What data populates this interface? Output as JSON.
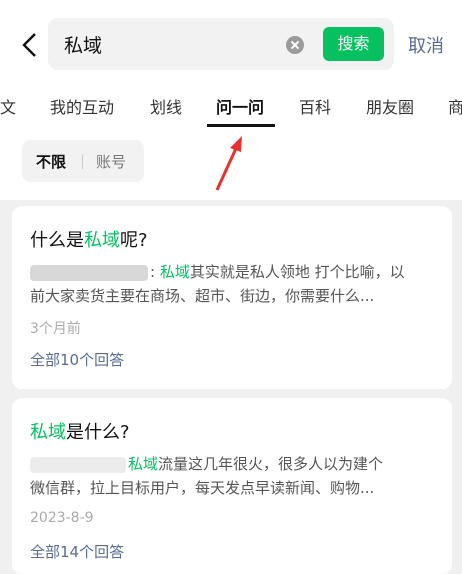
{
  "search": {
    "query": "私域",
    "button": "搜索",
    "cancel": "取消"
  },
  "tabs": [
    "文",
    "我的互动",
    "划线",
    "问一问",
    "百科",
    "朋友圈",
    "商"
  ],
  "active_tab": "问一问",
  "filters": [
    "不限",
    "账号"
  ],
  "results": [
    {
      "title_hl": "私域",
      "title_pre": "什么是",
      "title_post": "呢?",
      "snippet_hl": "私域",
      "snippet_line1": "其实就是私人领地 打个比喻，以",
      "snippet_line2": "前大家卖货主要在商场、超市、街边，你需要什么...",
      "time": "3个月前",
      "answers": "全部10个回答"
    },
    {
      "title_hl": "私域",
      "title_pre": "",
      "title_post": "是什么?",
      "snippet_hl": "私域",
      "snippet_line1": "流量这几年很火，很多人以为建个",
      "snippet_line2": "微信群，拉上目标用户，每天发点早读新闻、购物...",
      "time": "2023-8-9",
      "answers": "全部14个回答"
    }
  ]
}
